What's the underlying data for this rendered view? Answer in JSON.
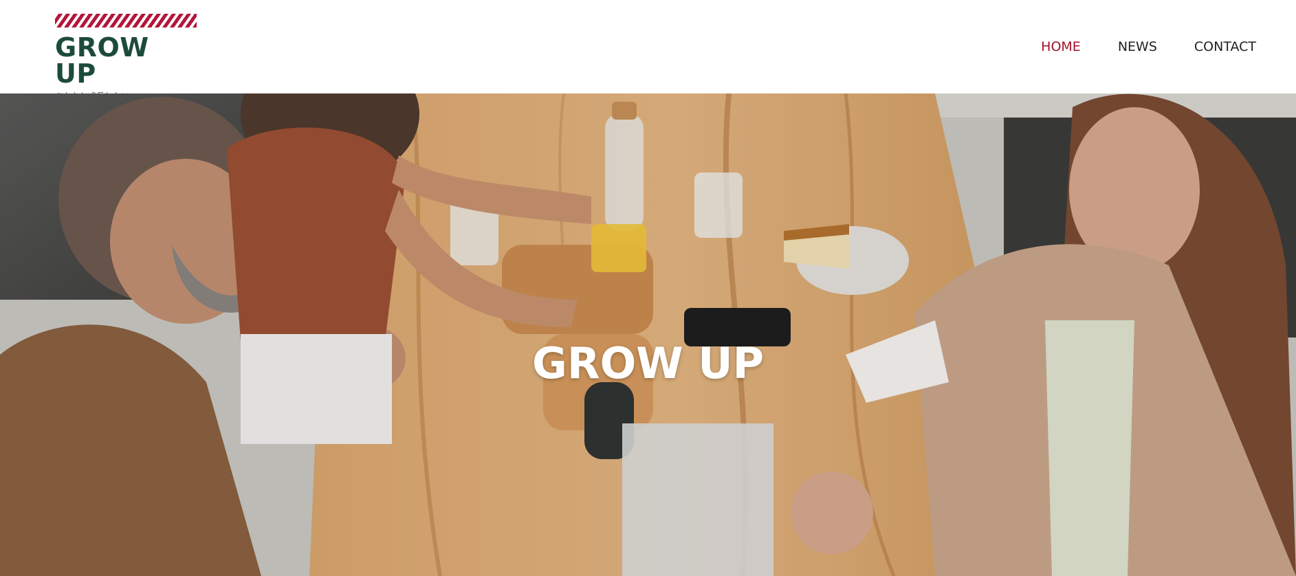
{
  "brand": {
    "title": "GROW UP",
    "tagline": "あなたと成長したい",
    "stripe_color": "#b3173a",
    "title_color": "#1d4b3a"
  },
  "nav": {
    "items": [
      {
        "label": "HOME",
        "active": true
      },
      {
        "label": "NEWS",
        "active": false
      },
      {
        "label": "CONTACT",
        "active": false
      }
    ],
    "active_color": "#a3122c"
  },
  "hero": {
    "title": "GROW UP"
  }
}
